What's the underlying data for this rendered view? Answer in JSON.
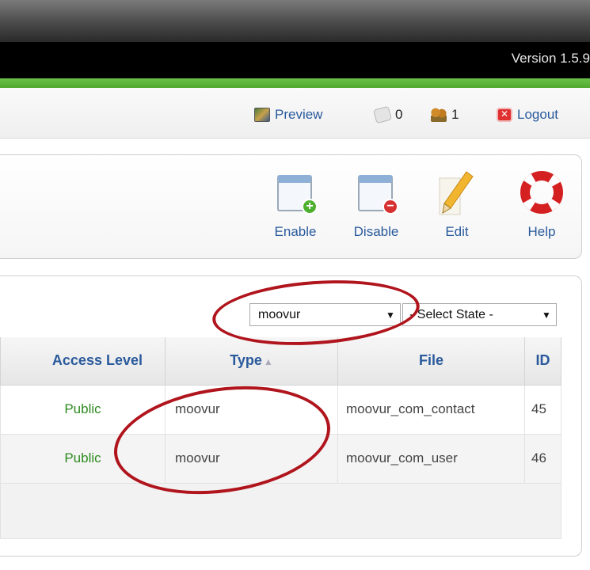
{
  "header": {
    "version": "Version 1.5.9"
  },
  "status_bar": {
    "preview_label": "Preview",
    "messages_count": "0",
    "users_count": "1",
    "logout_label": "Logout"
  },
  "toolbar": {
    "enable_label": "Enable",
    "disable_label": "Disable",
    "edit_label": "Edit",
    "help_label": "Help"
  },
  "filters": {
    "type_value": "moovur",
    "state_value": "- Select State -"
  },
  "table": {
    "headers": {
      "access": "Access Level",
      "type": "Type",
      "file": "File",
      "id": "ID"
    },
    "rows": [
      {
        "access": "Public",
        "type": "moovur",
        "file": "moovur_com_contact",
        "id": "45"
      },
      {
        "access": "Public",
        "type": "moovur",
        "file": "moovur_com_user",
        "id": "46"
      }
    ]
  },
  "colors": {
    "link_blue": "#2a5a9c",
    "public_green": "#2d8a1f",
    "annotation_red": "#b0141c",
    "header_green": "#5ab53a"
  }
}
